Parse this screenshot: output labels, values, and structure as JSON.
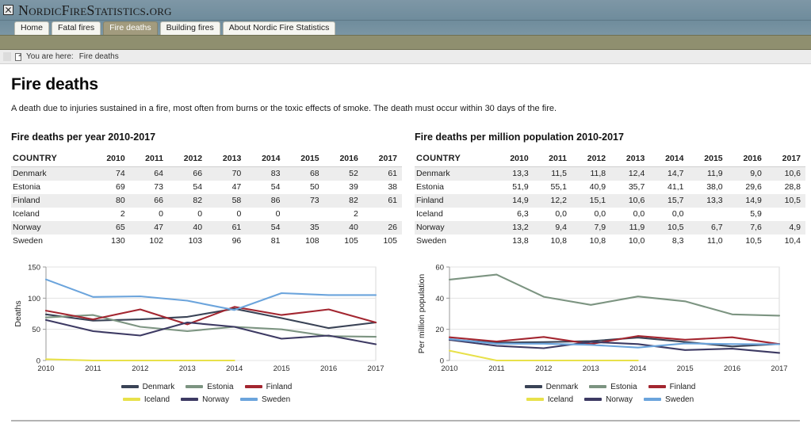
{
  "header": {
    "title": "NordicFireStatistics.org",
    "logo_icon": "broken-image-icon",
    "colors": {
      "header_bg": "#74909f",
      "band_bg": "#8f8f6f",
      "active_tab": "#a29b7e"
    }
  },
  "nav": {
    "tabs": [
      {
        "label": "Home",
        "active": false
      },
      {
        "label": "Fatal fires",
        "active": false
      },
      {
        "label": "Fire deaths",
        "active": true
      },
      {
        "label": "Building fires",
        "active": false
      },
      {
        "label": "About Nordic Fire Statistics",
        "active": false
      }
    ]
  },
  "breadcrumb": {
    "icon": "document-icon",
    "label": "You are here:",
    "current": "Fire deaths"
  },
  "page": {
    "title": "Fire deaths",
    "description": "A death due to injuries sustained in a fire, most often from burns or the toxic effects of smoke. The death must occur within 30 days of the fire."
  },
  "left_section": {
    "title": "Fire deaths per year 2010-2017",
    "table": {
      "columns": [
        "COUNTRY",
        "2010",
        "2011",
        "2012",
        "2013",
        "2014",
        "2015",
        "2016",
        "2017"
      ],
      "rows": [
        {
          "country": "Denmark",
          "values": [
            "74",
            "64",
            "66",
            "70",
            "83",
            "68",
            "52",
            "61"
          ]
        },
        {
          "country": "Estonia",
          "values": [
            "69",
            "73",
            "54",
            "47",
            "54",
            "50",
            "39",
            "38"
          ]
        },
        {
          "country": "Finland",
          "values": [
            "80",
            "66",
            "82",
            "58",
            "86",
            "73",
            "82",
            "61"
          ]
        },
        {
          "country": "Iceland",
          "values": [
            "2",
            "0",
            "0",
            "0",
            "0",
            "",
            "2",
            ""
          ]
        },
        {
          "country": "Norway",
          "values": [
            "65",
            "47",
            "40",
            "61",
            "54",
            "35",
            "40",
            "26"
          ]
        },
        {
          "country": "Sweden",
          "values": [
            "130",
            "102",
            "103",
            "96",
            "81",
            "108",
            "105",
            "105"
          ]
        }
      ]
    }
  },
  "right_section": {
    "title": "Fire deaths per million population 2010-2017",
    "table": {
      "columns": [
        "COUNTRY",
        "2010",
        "2011",
        "2012",
        "2013",
        "2014",
        "2015",
        "2016",
        "2017"
      ],
      "rows": [
        {
          "country": "Denmark",
          "values": [
            "13,3",
            "11,5",
            "11,8",
            "12,4",
            "14,7",
            "11,9",
            "9,0",
            "10,6"
          ]
        },
        {
          "country": "Estonia",
          "values": [
            "51,9",
            "55,1",
            "40,9",
            "35,7",
            "41,1",
            "38,0",
            "29,6",
            "28,8"
          ]
        },
        {
          "country": "Finland",
          "values": [
            "14,9",
            "12,2",
            "15,1",
            "10,6",
            "15,7",
            "13,3",
            "14,9",
            "10,5"
          ]
        },
        {
          "country": "Iceland",
          "values": [
            "6,3",
            "0,0",
            "0,0",
            "0,0",
            "0,0",
            "",
            "5,9",
            ""
          ]
        },
        {
          "country": "Norway",
          "values": [
            "13,2",
            "9,4",
            "7,9",
            "11,9",
            "10,5",
            "6,7",
            "7,6",
            "4,9"
          ]
        },
        {
          "country": "Sweden",
          "values": [
            "13,8",
            "10,8",
            "10,8",
            "10,0",
            "8,3",
            "11,0",
            "10,5",
            "10,4"
          ]
        }
      ]
    }
  },
  "legend": {
    "rows": [
      [
        {
          "label": "Denmark",
          "color": "#3a4356"
        },
        {
          "label": "Estonia",
          "color": "#7c9481"
        },
        {
          "label": "Finland",
          "color": "#a32630"
        }
      ],
      [
        {
          "label": "Iceland",
          "color": "#e8e14a"
        },
        {
          "label": "Norway",
          "color": "#3d3a63"
        },
        {
          "label": "Sweden",
          "color": "#6ba4dc"
        }
      ]
    ]
  },
  "chart_data": [
    {
      "id": "deaths-chart",
      "type": "line",
      "title": "Fire deaths per year 2010-2017",
      "xlabel": "",
      "ylabel": "Deaths",
      "x": [
        "2010",
        "2011",
        "2012",
        "2013",
        "2014",
        "2015",
        "2016",
        "2017"
      ],
      "ylim": [
        0,
        150
      ],
      "yticks": [
        0,
        50,
        100,
        150
      ],
      "grid": true,
      "legend_position": "bottom",
      "series": [
        {
          "name": "Denmark",
          "color": "#3a4356",
          "values": [
            74,
            64,
            66,
            70,
            83,
            68,
            52,
            61
          ]
        },
        {
          "name": "Estonia",
          "color": "#7c9481",
          "values": [
            69,
            73,
            54,
            47,
            54,
            50,
            39,
            38
          ]
        },
        {
          "name": "Finland",
          "color": "#a32630",
          "values": [
            80,
            66,
            82,
            58,
            86,
            73,
            82,
            61
          ]
        },
        {
          "name": "Iceland",
          "color": "#e8e14a",
          "values": [
            2,
            0,
            0,
            0,
            0,
            null,
            2,
            null
          ]
        },
        {
          "name": "Norway",
          "color": "#3d3a63",
          "values": [
            65,
            47,
            40,
            61,
            54,
            35,
            40,
            26
          ]
        },
        {
          "name": "Sweden",
          "color": "#6ba4dc",
          "values": [
            130,
            102,
            103,
            96,
            81,
            108,
            105,
            105
          ]
        }
      ]
    },
    {
      "id": "per-million-chart",
      "type": "line",
      "title": "Fire deaths per million population 2010-2017",
      "xlabel": "",
      "ylabel": "Per million population",
      "x": [
        "2010",
        "2011",
        "2012",
        "2013",
        "2014",
        "2015",
        "2016",
        "2017"
      ],
      "ylim": [
        0,
        60
      ],
      "yticks": [
        0,
        20,
        40,
        60
      ],
      "grid": true,
      "legend_position": "bottom",
      "series": [
        {
          "name": "Denmark",
          "color": "#3a4356",
          "values": [
            13.3,
            11.5,
            11.8,
            12.4,
            14.7,
            11.9,
            9.0,
            10.6
          ]
        },
        {
          "name": "Estonia",
          "color": "#7c9481",
          "values": [
            51.9,
            55.1,
            40.9,
            35.7,
            41.1,
            38.0,
            29.6,
            28.8
          ]
        },
        {
          "name": "Finland",
          "color": "#a32630",
          "values": [
            14.9,
            12.2,
            15.1,
            10.6,
            15.7,
            13.3,
            14.9,
            10.5
          ]
        },
        {
          "name": "Iceland",
          "color": "#e8e14a",
          "values": [
            6.3,
            0.0,
            0.0,
            0.0,
            0.0,
            null,
            5.9,
            null
          ]
        },
        {
          "name": "Norway",
          "color": "#3d3a63",
          "values": [
            13.2,
            9.4,
            7.9,
            11.9,
            10.5,
            6.7,
            7.6,
            4.9
          ]
        },
        {
          "name": "Sweden",
          "color": "#6ba4dc",
          "values": [
            13.8,
            10.8,
            10.8,
            10.0,
            8.3,
            11.0,
            10.5,
            10.4
          ]
        }
      ]
    }
  ]
}
